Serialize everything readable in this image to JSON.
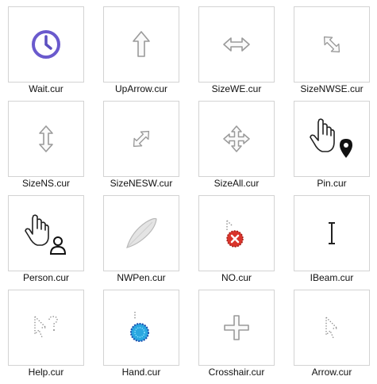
{
  "files": [
    {
      "name": "Wait.cur",
      "icon": "wait-clock-icon"
    },
    {
      "name": "UpArrow.cur",
      "icon": "up-arrow-icon"
    },
    {
      "name": "SizeWE.cur",
      "icon": "resize-horizontal-icon"
    },
    {
      "name": "SizeNWSE.cur",
      "icon": "resize-nwse-icon"
    },
    {
      "name": "SizeNS.cur",
      "icon": "resize-vertical-icon"
    },
    {
      "name": "SizeNESW.cur",
      "icon": "resize-nesw-icon"
    },
    {
      "name": "SizeAll.cur",
      "icon": "move-all-icon"
    },
    {
      "name": "Pin.cur",
      "icon": "hand-pin-icon"
    },
    {
      "name": "Person.cur",
      "icon": "hand-person-icon"
    },
    {
      "name": "NWPen.cur",
      "icon": "pen-feather-icon"
    },
    {
      "name": "NO.cur",
      "icon": "no-unavailable-icon"
    },
    {
      "name": "IBeam.cur",
      "icon": "ibeam-text-icon"
    },
    {
      "name": "Help.cur",
      "icon": "help-cursor-icon"
    },
    {
      "name": "Hand.cur",
      "icon": "hand-dotted-icon"
    },
    {
      "name": "Crosshair.cur",
      "icon": "crosshair-icon"
    },
    {
      "name": "Arrow.cur",
      "icon": "arrow-pointer-icon"
    }
  ]
}
